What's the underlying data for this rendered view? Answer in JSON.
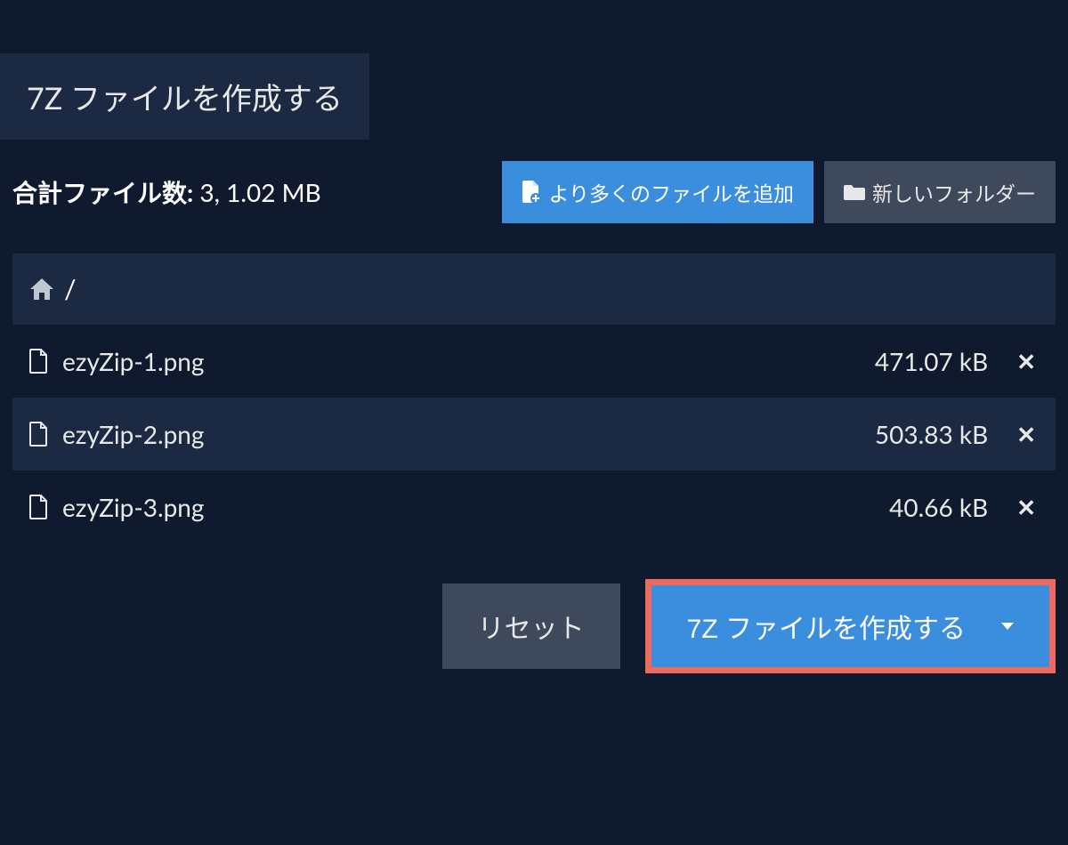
{
  "tab": {
    "title": "7Z ファイルを作成する"
  },
  "summary": {
    "label": "合計ファイル数:",
    "value": "3, 1.02 MB"
  },
  "toolbar": {
    "add_more_label": "より多くのファイルを追加",
    "new_folder_label": "新しいフォルダー"
  },
  "breadcrumb": {
    "sep": "/"
  },
  "files": [
    {
      "name": "ezyZip-1.png",
      "size": "471.07 kB"
    },
    {
      "name": "ezyZip-2.png",
      "size": "503.83 kB"
    },
    {
      "name": "ezyZip-3.png",
      "size": "40.66 kB"
    }
  ],
  "actions": {
    "reset_label": "リセット",
    "create_label": "7Z ファイルを作成する"
  }
}
